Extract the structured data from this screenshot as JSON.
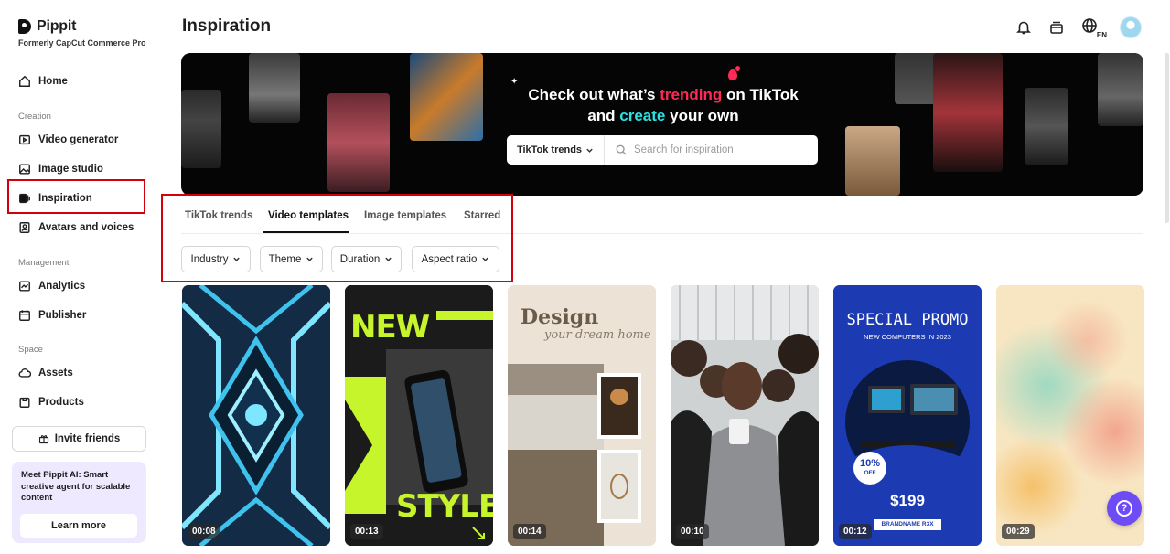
{
  "sidebar": {
    "logo": "Pippit",
    "subtitle": "Formerly CapCut Commerce Pro",
    "home": "Home",
    "section_creation": "Creation",
    "video_generator": "Video generator",
    "image_studio": "Image studio",
    "inspiration": "Inspiration",
    "avatars_voices": "Avatars and voices",
    "section_management": "Management",
    "analytics": "Analytics",
    "publisher": "Publisher",
    "section_space": "Space",
    "assets": "Assets",
    "products": "Products",
    "invite": "Invite friends",
    "promo_text": "Meet Pippit AI: Smart creative agent for scalable content",
    "learn_more": "Learn more"
  },
  "header": {
    "title": "Inspiration",
    "lang": "EN"
  },
  "banner": {
    "line1_pre": "Check out what’s ",
    "line1_hl": "trending",
    "line1_post": " on TikTok",
    "line2_pre": "and ",
    "line2_hl": "create",
    "line2_post": " your own",
    "select_label": "TikTok trends",
    "search_placeholder": "Search for inspiration"
  },
  "tabs": [
    "TikTok trends",
    "Video templates",
    "Image templates",
    "Starred"
  ],
  "active_tab": "Video templates",
  "filters": [
    "Industry",
    "Theme",
    "Duration",
    "Aspect ratio"
  ],
  "cards": [
    {
      "duration": "00:08"
    },
    {
      "duration": "00:13",
      "text_top": "NEW",
      "text_bottom": "STYLE"
    },
    {
      "duration": "00:14",
      "title": "Design",
      "subtitle": "your dream home"
    },
    {
      "duration": "00:10"
    },
    {
      "duration": "00:12",
      "title": "SPECIAL PROMO",
      "subtitle": "NEW COMPUTERS IN 2023",
      "badge_pct": "10%",
      "badge_off": "OFF",
      "price": "$199",
      "brand": "BRANDNAME R3X"
    },
    {
      "duration": "00:29"
    }
  ],
  "colors": {
    "accent": "#6d4cf5",
    "highlight_red": "#d4000b",
    "tiktok_red": "#ff2a55",
    "tiktok_cyan": "#29e3e3"
  }
}
